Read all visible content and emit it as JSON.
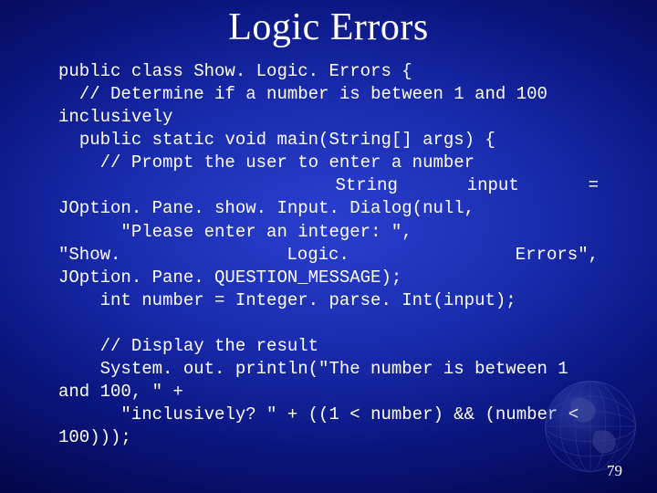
{
  "title": "Logic Errors",
  "page_number": "79",
  "code": {
    "l1": "public class Show. Logic. Errors {",
    "l2": "  // Determine if a number is between 1 and 100 inclusively",
    "l3": "  public static void main(String[] args) {",
    "l4": "    // Prompt the user to enter a number",
    "l5a": "    String",
    "l5b": "input",
    "l5c": "=",
    "l5d": "JOption. Pane. show. Input. Dialog(null,",
    "l6": "      \"Please enter an integer: \",",
    "l7a": "\"Show. Logic. Errors\",",
    "l7b": "JOption. Pane. QUESTION_MESSAGE);",
    "l8": "    int number = Integer. parse. Int(input);",
    "l9": "",
    "l10": "    // Display the result",
    "l11": "    System. out. println(\"The number is between 1 and 100, \" +",
    "l12": "      \"inclusively? \" + ((1 < number) && (number < 100)));"
  }
}
